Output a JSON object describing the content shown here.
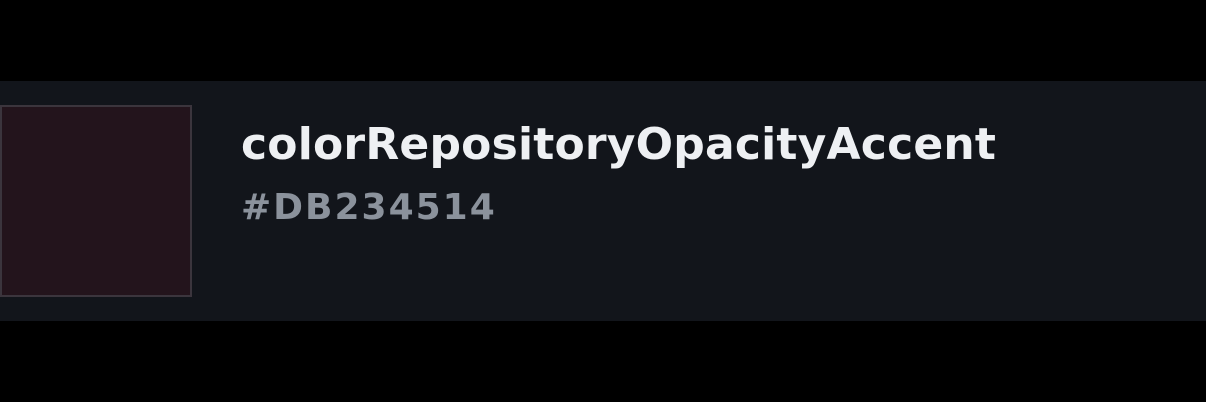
{
  "token": {
    "name": "colorRepositoryOpacityAccent",
    "value": "#DB234514",
    "swatch_color": "#23141c",
    "swatch_border_color": "#3b353d"
  },
  "colors": {
    "page_background": "#000000",
    "card_background": "#12151b",
    "name_text": "#eef0f3",
    "value_text": "#8b929c"
  }
}
